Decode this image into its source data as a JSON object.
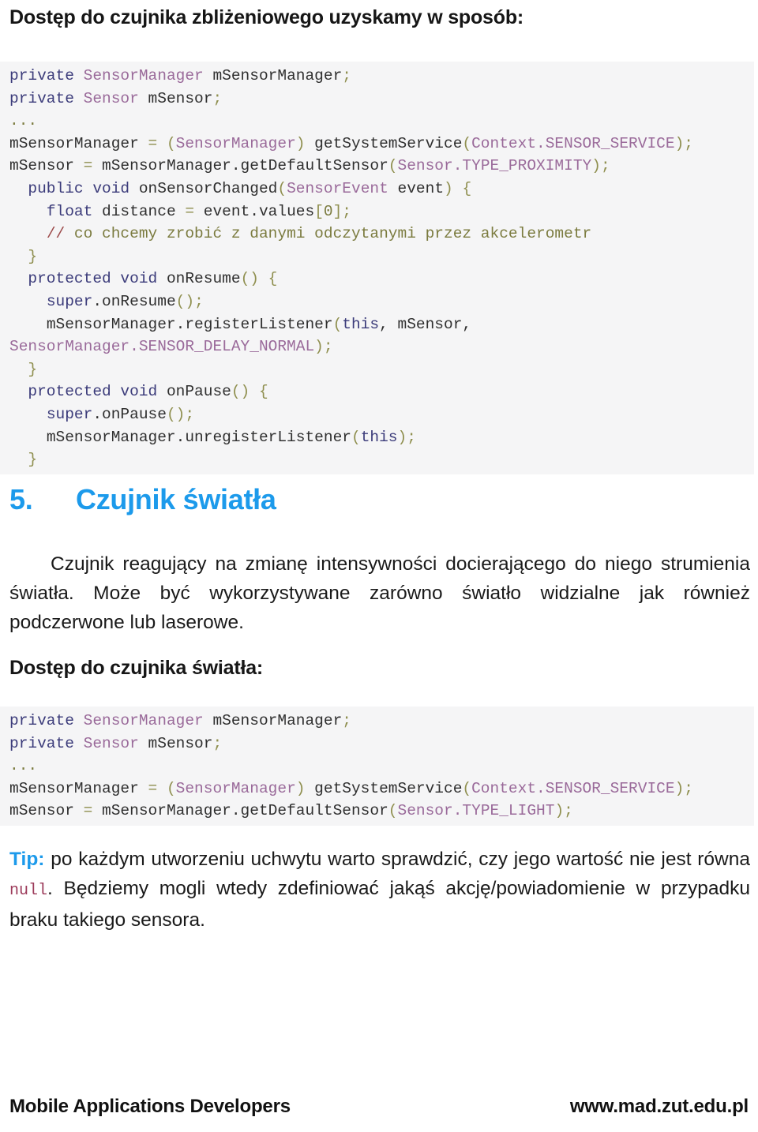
{
  "document": {
    "intro_heading": "Dostęp do czujnika zbliżeniowego uzyskamy w sposób:",
    "access_light_heading": "Dostęp do czujnika światła:"
  },
  "code_block_proximity": {
    "language": "java",
    "lines": [
      [
        {
          "t": "private ",
          "c": "kw"
        },
        {
          "t": "SensorManager",
          "c": "typ"
        },
        {
          "t": " mSensorManager",
          "c": "pln"
        },
        {
          "t": ";",
          "c": "pun"
        }
      ],
      [
        {
          "t": "private ",
          "c": "kw"
        },
        {
          "t": "Sensor",
          "c": "typ"
        },
        {
          "t": " mSensor",
          "c": "pln"
        },
        {
          "t": ";",
          "c": "pun"
        }
      ],
      [
        {
          "t": "...",
          "c": "cmt"
        }
      ],
      [
        {
          "t": "mSensorManager ",
          "c": "pln"
        },
        {
          "t": "=",
          "c": "pun"
        },
        {
          "t": " ",
          "c": "pln"
        },
        {
          "t": "(",
          "c": "pun"
        },
        {
          "t": "SensorManager",
          "c": "typ"
        },
        {
          "t": ")",
          "c": "pun"
        },
        {
          "t": " getSystemService",
          "c": "pln"
        },
        {
          "t": "(",
          "c": "pun"
        },
        {
          "t": "Context.SENSOR_SERVICE",
          "c": "typ"
        },
        {
          "t": ")",
          "c": "pun"
        },
        {
          "t": ";",
          "c": "pun"
        }
      ],
      [
        {
          "t": "mSensor ",
          "c": "pln"
        },
        {
          "t": "=",
          "c": "pun"
        },
        {
          "t": " mSensorManager.getDefaultSensor",
          "c": "pln"
        },
        {
          "t": "(",
          "c": "pun"
        },
        {
          "t": "Sensor.TYPE_PROXIMITY",
          "c": "typ"
        },
        {
          "t": ")",
          "c": "pun"
        },
        {
          "t": ";",
          "c": "pun"
        }
      ],
      [
        {
          "t": "  ",
          "c": "pln"
        },
        {
          "t": "public void ",
          "c": "kw"
        },
        {
          "t": "onSensorChanged",
          "c": "pln"
        },
        {
          "t": "(",
          "c": "pun"
        },
        {
          "t": "SensorEvent",
          "c": "typ"
        },
        {
          "t": " event",
          "c": "pln"
        },
        {
          "t": ")",
          "c": "pun"
        },
        {
          "t": " ",
          "c": "pln"
        },
        {
          "t": "{",
          "c": "pun"
        }
      ],
      [
        {
          "t": "    ",
          "c": "pln"
        },
        {
          "t": "float ",
          "c": "kw"
        },
        {
          "t": "distance ",
          "c": "pln"
        },
        {
          "t": "=",
          "c": "pun"
        },
        {
          "t": " event.values",
          "c": "pln"
        },
        {
          "t": "[",
          "c": "pun"
        },
        {
          "t": "0",
          "c": "num"
        },
        {
          "t": "]",
          "c": "pun"
        },
        {
          "t": ";",
          "c": "pun"
        }
      ],
      [
        {
          "t": "    ",
          "c": "pln"
        },
        {
          "t": "//",
          "c": "cmtd"
        },
        {
          "t": " co chcemy zrobić z danymi odczytanymi przez akcelerometr",
          "c": "cmt"
        }
      ],
      [
        {
          "t": "  ",
          "c": "pln"
        },
        {
          "t": "}",
          "c": "pun"
        }
      ],
      [
        {
          "t": "  ",
          "c": "pln"
        },
        {
          "t": "protected void ",
          "c": "kw"
        },
        {
          "t": "onResume",
          "c": "pln"
        },
        {
          "t": "()",
          "c": "pun"
        },
        {
          "t": " ",
          "c": "pln"
        },
        {
          "t": "{",
          "c": "pun"
        }
      ],
      [
        {
          "t": "    ",
          "c": "pln"
        },
        {
          "t": "super",
          "c": "kw"
        },
        {
          "t": ".onResume",
          "c": "pln"
        },
        {
          "t": "()",
          "c": "pun"
        },
        {
          "t": ";",
          "c": "pun"
        }
      ],
      [
        {
          "t": "    ",
          "c": "pln"
        },
        {
          "t": "mSensorManager.registerListener",
          "c": "pln"
        },
        {
          "t": "(",
          "c": "pun"
        },
        {
          "t": "this",
          "c": "kw"
        },
        {
          "t": ", mSensor,",
          "c": "pln"
        }
      ],
      [
        {
          "t": "SensorManager",
          "c": "typ"
        },
        {
          "t": ".SENSOR_DELAY_NORMAL",
          "c": "typ"
        },
        {
          "t": ")",
          "c": "pun"
        },
        {
          "t": ";",
          "c": "pun"
        }
      ],
      [
        {
          "t": "  ",
          "c": "pln"
        },
        {
          "t": "}",
          "c": "pun"
        }
      ],
      [
        {
          "t": "  ",
          "c": "pln"
        },
        {
          "t": "protected void ",
          "c": "kw"
        },
        {
          "t": "onPause",
          "c": "pln"
        },
        {
          "t": "()",
          "c": "pun"
        },
        {
          "t": " ",
          "c": "pln"
        },
        {
          "t": "{",
          "c": "pun"
        }
      ],
      [
        {
          "t": "    ",
          "c": "pln"
        },
        {
          "t": "super",
          "c": "kw"
        },
        {
          "t": ".onPause",
          "c": "pln"
        },
        {
          "t": "()",
          "c": "pun"
        },
        {
          "t": ";",
          "c": "pun"
        }
      ],
      [
        {
          "t": "    ",
          "c": "pln"
        },
        {
          "t": "mSensorManager.unregisterListener",
          "c": "pln"
        },
        {
          "t": "(",
          "c": "pun"
        },
        {
          "t": "this",
          "c": "kw"
        },
        {
          "t": ")",
          "c": "pun"
        },
        {
          "t": ";",
          "c": "pun"
        }
      ],
      [
        {
          "t": "  ",
          "c": "pln"
        },
        {
          "t": "}",
          "c": "pun"
        }
      ]
    ]
  },
  "section": {
    "number": "5.",
    "title": "Czujnik światła",
    "accent_color": "#1c9aeb"
  },
  "paragraph_light": {
    "text": "Czujnik reagujący na zmianę intensywności docierającego do niego strumienia światła. Może być wykorzystywane zarówno światło widzialne jak również podczerwone lub laserowe."
  },
  "code_block_light": {
    "language": "java",
    "lines": [
      [
        {
          "t": "private ",
          "c": "kw"
        },
        {
          "t": "SensorManager",
          "c": "typ"
        },
        {
          "t": " mSensorManager",
          "c": "pln"
        },
        {
          "t": ";",
          "c": "pun"
        }
      ],
      [
        {
          "t": "private ",
          "c": "kw"
        },
        {
          "t": "Sensor",
          "c": "typ"
        },
        {
          "t": " mSensor",
          "c": "pln"
        },
        {
          "t": ";",
          "c": "pun"
        }
      ],
      [
        {
          "t": "...",
          "c": "cmt"
        }
      ],
      [
        {
          "t": "mSensorManager ",
          "c": "pln"
        },
        {
          "t": "=",
          "c": "pun"
        },
        {
          "t": " ",
          "c": "pln"
        },
        {
          "t": "(",
          "c": "pun"
        },
        {
          "t": "SensorManager",
          "c": "typ"
        },
        {
          "t": ")",
          "c": "pun"
        },
        {
          "t": " getSystemService",
          "c": "pln"
        },
        {
          "t": "(",
          "c": "pun"
        },
        {
          "t": "Context.SENSOR_SERVICE",
          "c": "typ"
        },
        {
          "t": ")",
          "c": "pun"
        },
        {
          "t": ";",
          "c": "pun"
        }
      ],
      [
        {
          "t": "mSensor ",
          "c": "pln"
        },
        {
          "t": "=",
          "c": "pun"
        },
        {
          "t": " mSensorManager.getDefaultSensor",
          "c": "pln"
        },
        {
          "t": "(",
          "c": "pun"
        },
        {
          "t": "Sensor.TYPE_LIGHT",
          "c": "typ"
        },
        {
          "t": ")",
          "c": "pun"
        },
        {
          "t": ";",
          "c": "pun"
        }
      ]
    ]
  },
  "tip": {
    "label": "Tip:",
    "text_before": " po każdym utworzeniu uchwytu warto sprawdzić, czy jego wartość nie jest równa ",
    "code_value": "null",
    "text_after": ". Będziemy mogli wtedy zdefiniować jakąś akcję/powiadomienie w przypadku braku takiego sensora.",
    "label_color": "#1c9aeb",
    "code_color": "#9c3a5a"
  },
  "footer": {
    "left": "Mobile Applications Developers",
    "right": "www.mad.zut.edu.pl"
  }
}
